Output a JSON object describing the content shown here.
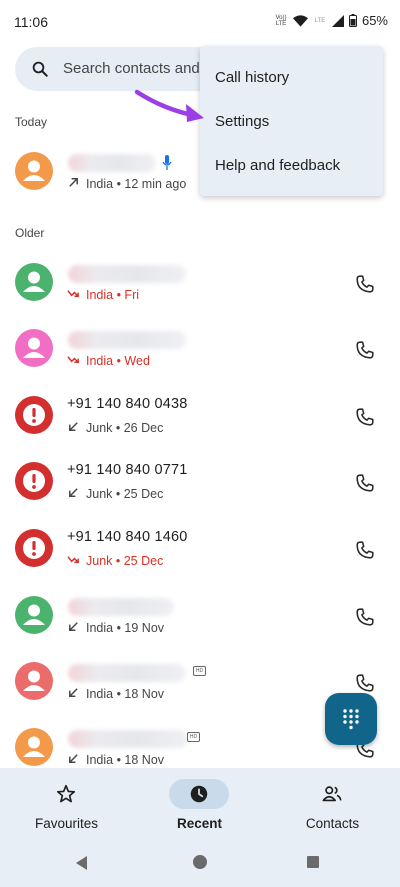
{
  "status_bar": {
    "time": "11:06",
    "net1_top": "Vo))",
    "net1_bottom": "LTE",
    "net2": "LTE",
    "battery": "65%"
  },
  "search": {
    "placeholder": "Search contacts and"
  },
  "sections": {
    "today": "Today",
    "older": "Older"
  },
  "menu": {
    "items": [
      {
        "label": "Call history"
      },
      {
        "label": "Settings"
      },
      {
        "label": "Help and feedback"
      }
    ]
  },
  "calls": [
    {
      "name": "",
      "detail": "India • 12 min ago",
      "direction": "outgoing",
      "missed": false,
      "avatar_color": "#f29a4a"
    },
    {
      "name": "",
      "detail": "India • Fri",
      "direction": "missed",
      "missed": true,
      "avatar_color": "#4bb36d"
    },
    {
      "name": "",
      "detail": "India • Wed",
      "direction": "missed",
      "missed": true,
      "avatar_color": "#f06ec4"
    },
    {
      "name": "+91 140 840 0438",
      "detail": "Junk • 26 Dec",
      "direction": "incoming",
      "missed": false,
      "avatar_color": "#d32f2f"
    },
    {
      "name": "+91 140 840 0771",
      "detail": "Junk • 25 Dec",
      "direction": "incoming",
      "missed": false,
      "avatar_color": "#d32f2f"
    },
    {
      "name": "+91 140 840 1460",
      "detail": "Junk • 25 Dec",
      "direction": "missed",
      "missed": true,
      "avatar_color": "#d32f2f"
    },
    {
      "name": "",
      "detail": "India • 19 Nov",
      "direction": "incoming",
      "missed": false,
      "avatar_color": "#4bb36d"
    },
    {
      "name": "",
      "detail": "India • 18 Nov",
      "direction": "incoming",
      "missed": false,
      "avatar_color": "#ec6b6b"
    },
    {
      "name": "",
      "detail": "India • 18 Nov",
      "direction": "incoming",
      "missed": false,
      "avatar_color": "#f29a4a"
    }
  ],
  "hd_label": "HD",
  "bottom_nav": {
    "favourites": "Favourites",
    "recent": "Recent",
    "contacts": "Contacts"
  },
  "colors": {
    "accent": "#11658a",
    "missed": "#d93025",
    "surface": "#e7eef5",
    "pointer_arrow": "#9b3ee6"
  }
}
